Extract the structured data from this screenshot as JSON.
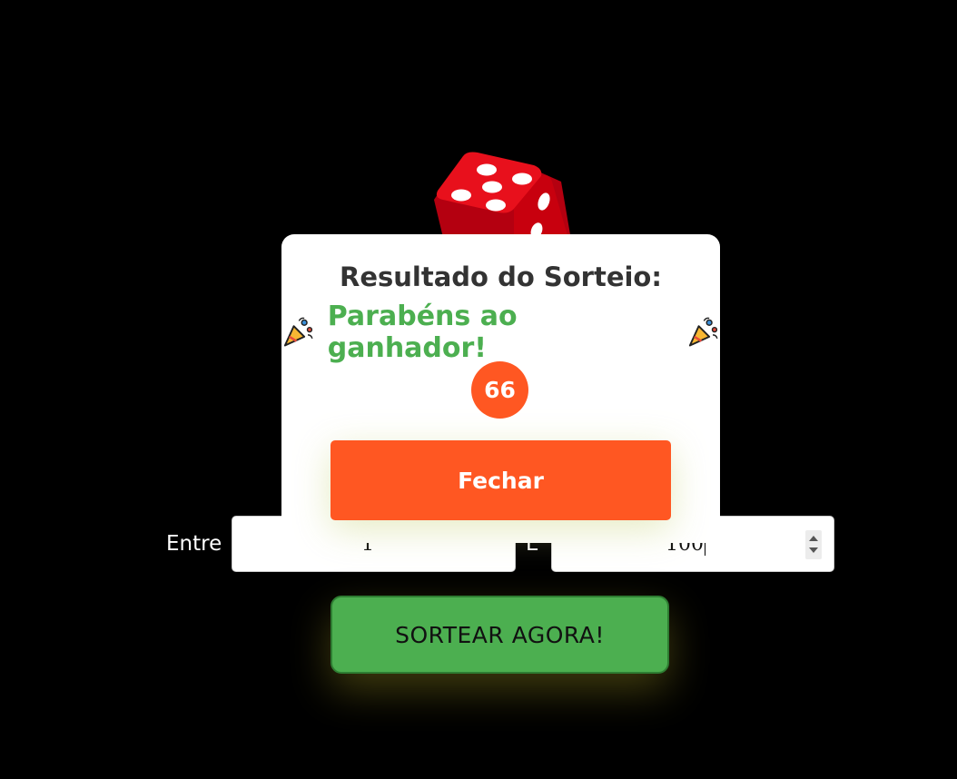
{
  "page": {
    "background": "#000000",
    "dice_icon": "red-dice-icon"
  },
  "form": {
    "entre_label": "Entre",
    "e_label": "E",
    "min_value": "1",
    "max_value": "100",
    "draw_button_label": "SORTEAR AGORA!",
    "draw_button_color": "#4caf50"
  },
  "modal": {
    "title": "Resultado do Sorteio:",
    "congrats_message": "Parabéns ao ganhador!",
    "winner_number": "66",
    "close_button_label": "Fechar",
    "accent_color": "#ff5722",
    "congrats_color": "#4caf50",
    "icons": [
      "party-popper-icon",
      "party-popper-icon"
    ]
  }
}
